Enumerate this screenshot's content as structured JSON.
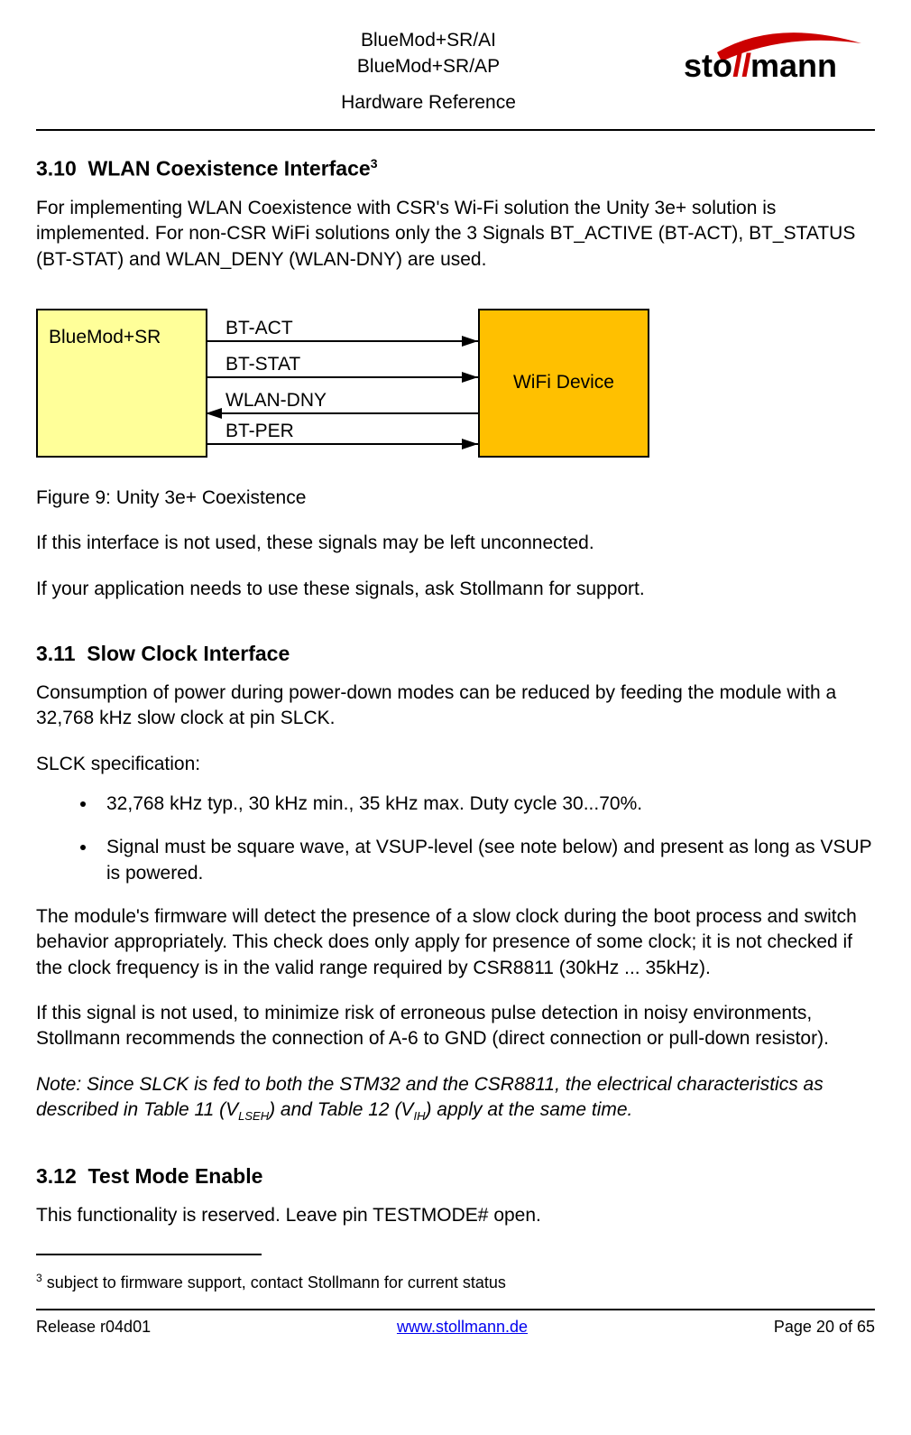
{
  "header": {
    "title1": "BlueMod+SR/AI",
    "title2": "BlueMod+SR/AP",
    "subtitle": "Hardware Reference",
    "logo_text1": "sto",
    "logo_text2": "mann"
  },
  "sections": {
    "s310": {
      "num": "3.10",
      "title": "WLAN Coexistence Interface",
      "sup": "3",
      "p1": "For implementing WLAN Coexistence with CSR's Wi-Fi solution the Unity 3e+ solution is implemented. For non-CSR WiFi solutions only the 3 Signals BT_ACTIVE (BT-ACT), BT_STATUS (BT-STAT) and WLAN_DENY (WLAN-DNY) are used.",
      "figure_caption": "Figure 9: Unity 3e+ Coexistence",
      "p2": "If this interface is not used, these signals may be left unconnected.",
      "p3": "If your application needs to use these signals, ask Stollmann for support."
    },
    "s311": {
      "num": "3.11",
      "title": "Slow Clock Interface",
      "p1": "Consumption of power during power-down modes can be reduced by feeding the module with a 32,768 kHz slow clock at pin SLCK.",
      "p2": "SLCK specification:",
      "li1": "32,768 kHz typ., 30 kHz min., 35 kHz max. Duty cycle 30...70%.",
      "li2": "Signal must be square wave, at VSUP-level (see note below) and present as long as VSUP is powered.",
      "p3": "The module's firmware will detect the presence of a slow clock during the boot process and switch behavior appropriately. This check does only apply for presence of some clock; it is not checked if the clock frequency is in the valid range required by CSR8811 (30kHz ... 35kHz).",
      "p4": "If this signal is not used, to minimize risk of erroneous pulse detection in noisy environments, Stollmann recommends the connection of A-6 to GND (direct connection or pull-down resistor).",
      "note_pre": "Note: Since SLCK is fed to both the STM32 and the CSR8811, the electrical characteristics as described in Table 11 (V",
      "note_sub1": "LSEH",
      "note_mid": ") and Table 12 (V",
      "note_sub2": "IH",
      "note_post": ") apply at the same time."
    },
    "s312": {
      "num": "3.12",
      "title": "Test Mode Enable",
      "p1": "This functionality is reserved. Leave pin TESTMODE# open."
    }
  },
  "diagram": {
    "box_left": "BlueMod+SR",
    "box_right": "WiFi Device",
    "sig1": "BT-ACT",
    "sig2": "BT-STAT",
    "sig3": "WLAN-DNY",
    "sig4": "BT-PER"
  },
  "footnote": {
    "ref": "3",
    "text": " subject to firmware support, contact Stollmann for current status"
  },
  "footer": {
    "release": "Release r04d01",
    "link": "www.stollmann.de",
    "page": "Page 20 of 65"
  }
}
